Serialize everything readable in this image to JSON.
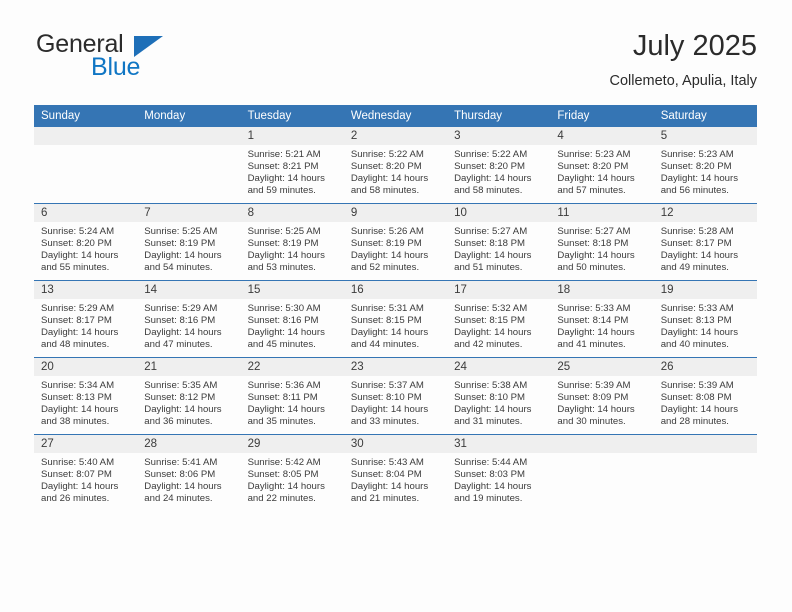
{
  "logo": {
    "primary_text": "General",
    "secondary_text": "Blue",
    "primary_color": "#2b2b2b",
    "secondary_color": "#1076c4",
    "flag_color": "#1e6fb8",
    "icon": "triangle-flag-icon"
  },
  "header": {
    "title": "July 2025",
    "subtitle": "Collemeto, Apulia, Italy"
  },
  "theme": {
    "header_bg": "#3575b4",
    "header_text": "#ffffff",
    "daynum_bg": "#efefef",
    "row_border": "#3575b4",
    "page_bg": "#fdfdfd",
    "body_text": "#3b3b3b"
  },
  "weekday_headers": [
    "Sunday",
    "Monday",
    "Tuesday",
    "Wednesday",
    "Thursday",
    "Friday",
    "Saturday"
  ],
  "weeks": [
    [
      {
        "day": "",
        "sunrise": "",
        "sunset": "",
        "daylight_line1": "",
        "daylight_line2": ""
      },
      {
        "day": "",
        "sunrise": "",
        "sunset": "",
        "daylight_line1": "",
        "daylight_line2": ""
      },
      {
        "day": "1",
        "sunrise": "Sunrise: 5:21 AM",
        "sunset": "Sunset: 8:21 PM",
        "daylight_line1": "Daylight: 14 hours",
        "daylight_line2": "and 59 minutes."
      },
      {
        "day": "2",
        "sunrise": "Sunrise: 5:22 AM",
        "sunset": "Sunset: 8:20 PM",
        "daylight_line1": "Daylight: 14 hours",
        "daylight_line2": "and 58 minutes."
      },
      {
        "day": "3",
        "sunrise": "Sunrise: 5:22 AM",
        "sunset": "Sunset: 8:20 PM",
        "daylight_line1": "Daylight: 14 hours",
        "daylight_line2": "and 58 minutes."
      },
      {
        "day": "4",
        "sunrise": "Sunrise: 5:23 AM",
        "sunset": "Sunset: 8:20 PM",
        "daylight_line1": "Daylight: 14 hours",
        "daylight_line2": "and 57 minutes."
      },
      {
        "day": "5",
        "sunrise": "Sunrise: 5:23 AM",
        "sunset": "Sunset: 8:20 PM",
        "daylight_line1": "Daylight: 14 hours",
        "daylight_line2": "and 56 minutes."
      }
    ],
    [
      {
        "day": "6",
        "sunrise": "Sunrise: 5:24 AM",
        "sunset": "Sunset: 8:20 PM",
        "daylight_line1": "Daylight: 14 hours",
        "daylight_line2": "and 55 minutes."
      },
      {
        "day": "7",
        "sunrise": "Sunrise: 5:25 AM",
        "sunset": "Sunset: 8:19 PM",
        "daylight_line1": "Daylight: 14 hours",
        "daylight_line2": "and 54 minutes."
      },
      {
        "day": "8",
        "sunrise": "Sunrise: 5:25 AM",
        "sunset": "Sunset: 8:19 PM",
        "daylight_line1": "Daylight: 14 hours",
        "daylight_line2": "and 53 minutes."
      },
      {
        "day": "9",
        "sunrise": "Sunrise: 5:26 AM",
        "sunset": "Sunset: 8:19 PM",
        "daylight_line1": "Daylight: 14 hours",
        "daylight_line2": "and 52 minutes."
      },
      {
        "day": "10",
        "sunrise": "Sunrise: 5:27 AM",
        "sunset": "Sunset: 8:18 PM",
        "daylight_line1": "Daylight: 14 hours",
        "daylight_line2": "and 51 minutes."
      },
      {
        "day": "11",
        "sunrise": "Sunrise: 5:27 AM",
        "sunset": "Sunset: 8:18 PM",
        "daylight_line1": "Daylight: 14 hours",
        "daylight_line2": "and 50 minutes."
      },
      {
        "day": "12",
        "sunrise": "Sunrise: 5:28 AM",
        "sunset": "Sunset: 8:17 PM",
        "daylight_line1": "Daylight: 14 hours",
        "daylight_line2": "and 49 minutes."
      }
    ],
    [
      {
        "day": "13",
        "sunrise": "Sunrise: 5:29 AM",
        "sunset": "Sunset: 8:17 PM",
        "daylight_line1": "Daylight: 14 hours",
        "daylight_line2": "and 48 minutes."
      },
      {
        "day": "14",
        "sunrise": "Sunrise: 5:29 AM",
        "sunset": "Sunset: 8:16 PM",
        "daylight_line1": "Daylight: 14 hours",
        "daylight_line2": "and 47 minutes."
      },
      {
        "day": "15",
        "sunrise": "Sunrise: 5:30 AM",
        "sunset": "Sunset: 8:16 PM",
        "daylight_line1": "Daylight: 14 hours",
        "daylight_line2": "and 45 minutes."
      },
      {
        "day": "16",
        "sunrise": "Sunrise: 5:31 AM",
        "sunset": "Sunset: 8:15 PM",
        "daylight_line1": "Daylight: 14 hours",
        "daylight_line2": "and 44 minutes."
      },
      {
        "day": "17",
        "sunrise": "Sunrise: 5:32 AM",
        "sunset": "Sunset: 8:15 PM",
        "daylight_line1": "Daylight: 14 hours",
        "daylight_line2": "and 42 minutes."
      },
      {
        "day": "18",
        "sunrise": "Sunrise: 5:33 AM",
        "sunset": "Sunset: 8:14 PM",
        "daylight_line1": "Daylight: 14 hours",
        "daylight_line2": "and 41 minutes."
      },
      {
        "day": "19",
        "sunrise": "Sunrise: 5:33 AM",
        "sunset": "Sunset: 8:13 PM",
        "daylight_line1": "Daylight: 14 hours",
        "daylight_line2": "and 40 minutes."
      }
    ],
    [
      {
        "day": "20",
        "sunrise": "Sunrise: 5:34 AM",
        "sunset": "Sunset: 8:13 PM",
        "daylight_line1": "Daylight: 14 hours",
        "daylight_line2": "and 38 minutes."
      },
      {
        "day": "21",
        "sunrise": "Sunrise: 5:35 AM",
        "sunset": "Sunset: 8:12 PM",
        "daylight_line1": "Daylight: 14 hours",
        "daylight_line2": "and 36 minutes."
      },
      {
        "day": "22",
        "sunrise": "Sunrise: 5:36 AM",
        "sunset": "Sunset: 8:11 PM",
        "daylight_line1": "Daylight: 14 hours",
        "daylight_line2": "and 35 minutes."
      },
      {
        "day": "23",
        "sunrise": "Sunrise: 5:37 AM",
        "sunset": "Sunset: 8:10 PM",
        "daylight_line1": "Daylight: 14 hours",
        "daylight_line2": "and 33 minutes."
      },
      {
        "day": "24",
        "sunrise": "Sunrise: 5:38 AM",
        "sunset": "Sunset: 8:10 PM",
        "daylight_line1": "Daylight: 14 hours",
        "daylight_line2": "and 31 minutes."
      },
      {
        "day": "25",
        "sunrise": "Sunrise: 5:39 AM",
        "sunset": "Sunset: 8:09 PM",
        "daylight_line1": "Daylight: 14 hours",
        "daylight_line2": "and 30 minutes."
      },
      {
        "day": "26",
        "sunrise": "Sunrise: 5:39 AM",
        "sunset": "Sunset: 8:08 PM",
        "daylight_line1": "Daylight: 14 hours",
        "daylight_line2": "and 28 minutes."
      }
    ],
    [
      {
        "day": "27",
        "sunrise": "Sunrise: 5:40 AM",
        "sunset": "Sunset: 8:07 PM",
        "daylight_line1": "Daylight: 14 hours",
        "daylight_line2": "and 26 minutes."
      },
      {
        "day": "28",
        "sunrise": "Sunrise: 5:41 AM",
        "sunset": "Sunset: 8:06 PM",
        "daylight_line1": "Daylight: 14 hours",
        "daylight_line2": "and 24 minutes."
      },
      {
        "day": "29",
        "sunrise": "Sunrise: 5:42 AM",
        "sunset": "Sunset: 8:05 PM",
        "daylight_line1": "Daylight: 14 hours",
        "daylight_line2": "and 22 minutes."
      },
      {
        "day": "30",
        "sunrise": "Sunrise: 5:43 AM",
        "sunset": "Sunset: 8:04 PM",
        "daylight_line1": "Daylight: 14 hours",
        "daylight_line2": "and 21 minutes."
      },
      {
        "day": "31",
        "sunrise": "Sunrise: 5:44 AM",
        "sunset": "Sunset: 8:03 PM",
        "daylight_line1": "Daylight: 14 hours",
        "daylight_line2": "and 19 minutes."
      },
      {
        "day": "",
        "sunrise": "",
        "sunset": "",
        "daylight_line1": "",
        "daylight_line2": ""
      },
      {
        "day": "",
        "sunrise": "",
        "sunset": "",
        "daylight_line1": "",
        "daylight_line2": ""
      }
    ]
  ]
}
